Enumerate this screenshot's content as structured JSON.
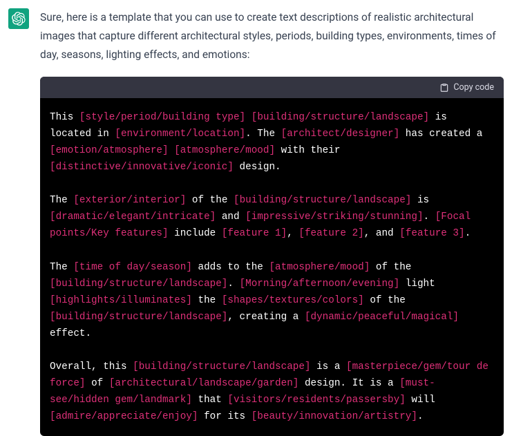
{
  "avatar": {
    "name": "chatgpt-logo"
  },
  "intro_text": "Sure, here is a template that you can use to create text descriptions of realistic architectural images that capture different architectural styles, periods, building types, environments, times of day, seasons, lighting effects, and emotions:",
  "copy_label": "Copy code",
  "template": [
    {
      "t": "plain",
      "v": "This "
    },
    {
      "t": "ph",
      "v": "[style/period/building type]"
    },
    {
      "t": "plain",
      "v": " "
    },
    {
      "t": "ph",
      "v": "[building/structure/landscape]"
    },
    {
      "t": "plain",
      "v": " is located in "
    },
    {
      "t": "ph",
      "v": "[environment/location]"
    },
    {
      "t": "plain",
      "v": ". The "
    },
    {
      "t": "ph",
      "v": "[architect/designer]"
    },
    {
      "t": "plain",
      "v": " has created a "
    },
    {
      "t": "ph",
      "v": "[emotion/atmosphere]"
    },
    {
      "t": "plain",
      "v": " "
    },
    {
      "t": "ph",
      "v": "[atmosphere/mood]"
    },
    {
      "t": "plain",
      "v": " with their "
    },
    {
      "t": "ph",
      "v": "[distinctive/innovative/iconic]"
    },
    {
      "t": "plain",
      "v": " design."
    },
    {
      "t": "br"
    },
    {
      "t": "br"
    },
    {
      "t": "plain",
      "v": "The "
    },
    {
      "t": "ph",
      "v": "[exterior/interior]"
    },
    {
      "t": "plain",
      "v": " of the "
    },
    {
      "t": "ph",
      "v": "[building/structure/landscape]"
    },
    {
      "t": "plain",
      "v": " is "
    },
    {
      "t": "ph",
      "v": "[dramatic/elegant/intricate]"
    },
    {
      "t": "plain",
      "v": " and "
    },
    {
      "t": "ph",
      "v": "[impressive/striking/stunning]"
    },
    {
      "t": "plain",
      "v": ". "
    },
    {
      "t": "ph",
      "v": "[Focal points/Key features]"
    },
    {
      "t": "plain",
      "v": " include "
    },
    {
      "t": "ph",
      "v": "[feature 1]"
    },
    {
      "t": "plain",
      "v": ", "
    },
    {
      "t": "ph",
      "v": "[feature 2]"
    },
    {
      "t": "plain",
      "v": ", and "
    },
    {
      "t": "ph",
      "v": "[feature 3]"
    },
    {
      "t": "plain",
      "v": "."
    },
    {
      "t": "br"
    },
    {
      "t": "br"
    },
    {
      "t": "plain",
      "v": "The "
    },
    {
      "t": "ph",
      "v": "[time of day/season]"
    },
    {
      "t": "plain",
      "v": " adds to the "
    },
    {
      "t": "ph",
      "v": "[atmosphere/mood]"
    },
    {
      "t": "plain",
      "v": " of the "
    },
    {
      "t": "ph",
      "v": "[building/structure/landscape]"
    },
    {
      "t": "plain",
      "v": ". "
    },
    {
      "t": "ph",
      "v": "[Morning/afternoon/evening]"
    },
    {
      "t": "plain",
      "v": " light "
    },
    {
      "t": "ph",
      "v": "[highlights/illuminates]"
    },
    {
      "t": "plain",
      "v": " the "
    },
    {
      "t": "ph",
      "v": "[shapes/textures/colors]"
    },
    {
      "t": "plain",
      "v": " of the "
    },
    {
      "t": "ph",
      "v": "[building/structure/landscape]"
    },
    {
      "t": "plain",
      "v": ", creating a "
    },
    {
      "t": "ph",
      "v": "[dynamic/peaceful/magical]"
    },
    {
      "t": "plain",
      "v": " effect."
    },
    {
      "t": "br"
    },
    {
      "t": "br"
    },
    {
      "t": "plain",
      "v": "Overall, this "
    },
    {
      "t": "ph",
      "v": "[building/structure/landscape]"
    },
    {
      "t": "plain",
      "v": " is a "
    },
    {
      "t": "ph",
      "v": "[masterpiece/gem/tour de force]"
    },
    {
      "t": "plain",
      "v": " of "
    },
    {
      "t": "ph",
      "v": "[architectural/landscape/garden]"
    },
    {
      "t": "plain",
      "v": " design. It is a "
    },
    {
      "t": "ph",
      "v": "[must-see/hidden gem/landmark]"
    },
    {
      "t": "plain",
      "v": " that "
    },
    {
      "t": "ph",
      "v": "[visitors/residents/passersby]"
    },
    {
      "t": "plain",
      "v": " will "
    },
    {
      "t": "ph",
      "v": "[admire/appreciate/enjoy]"
    },
    {
      "t": "plain",
      "v": " for its "
    },
    {
      "t": "ph",
      "v": "[beauty/innovation/artistry]"
    },
    {
      "t": "plain",
      "v": "."
    }
  ]
}
